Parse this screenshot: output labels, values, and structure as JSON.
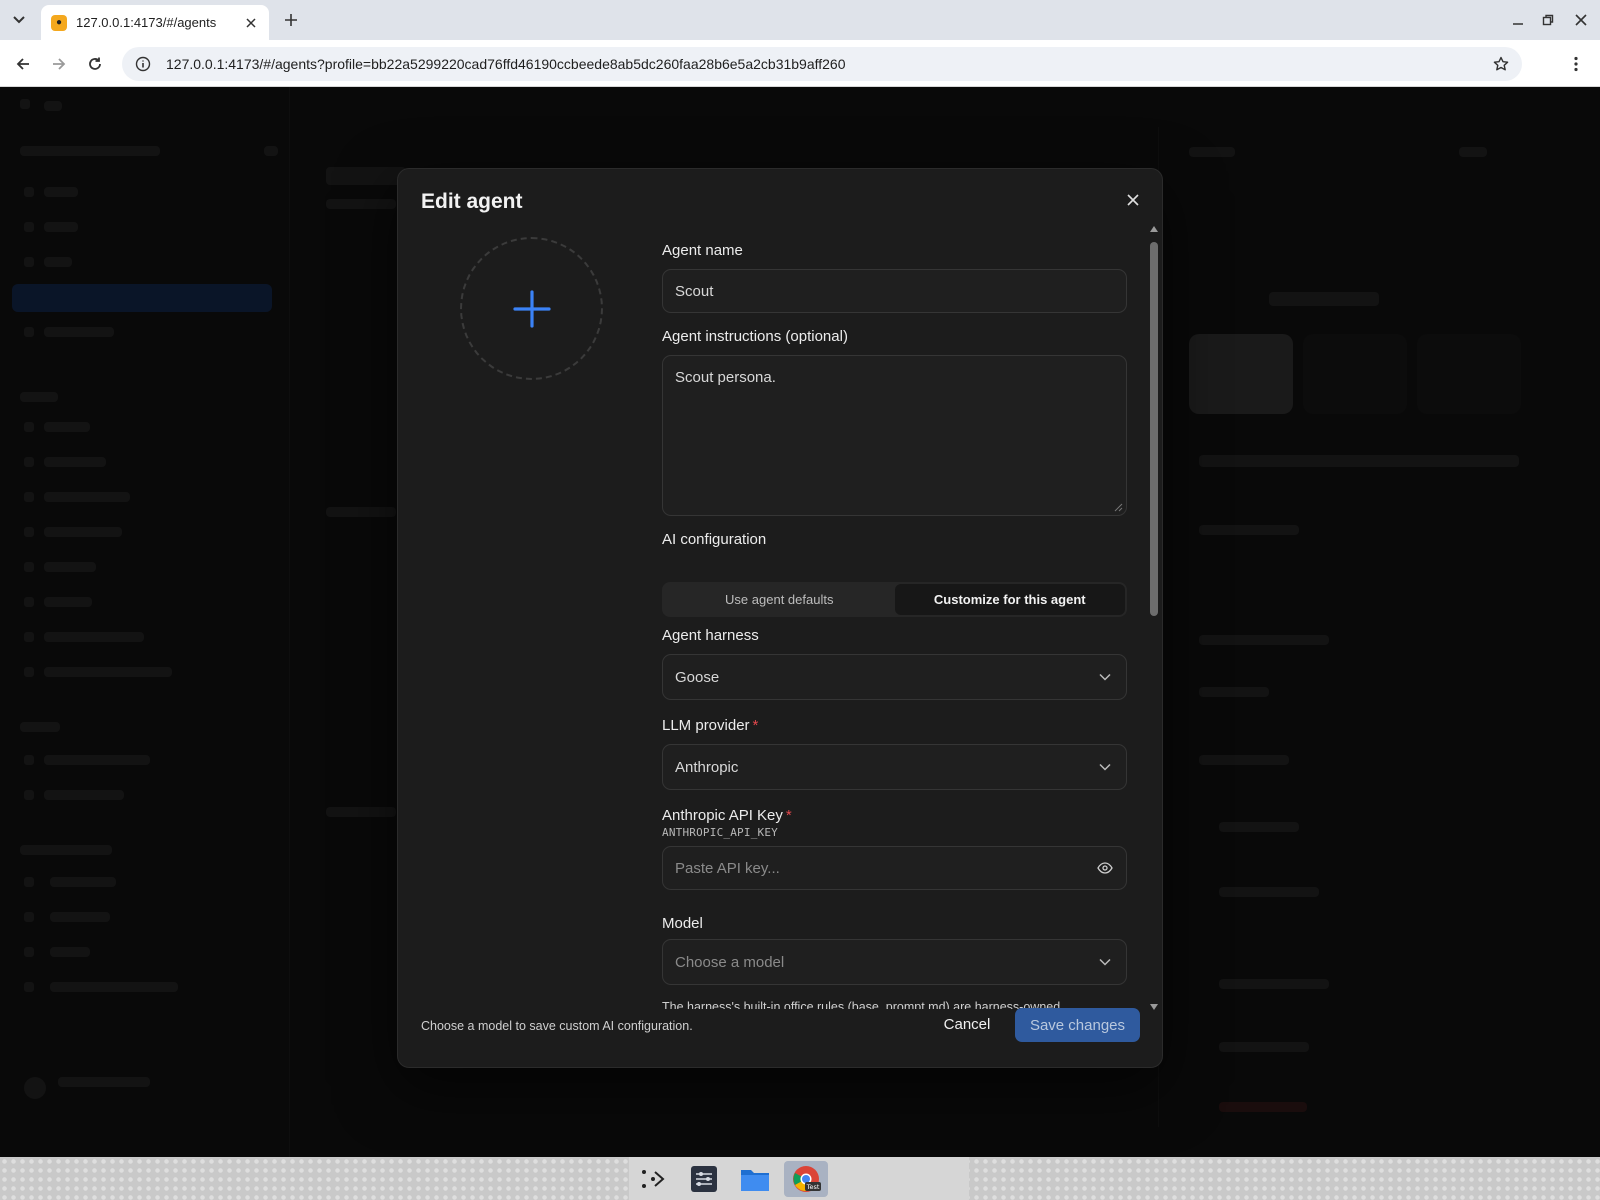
{
  "browser": {
    "tab_title": "127.0.0.1:4173/#/agents",
    "url": "127.0.0.1:4173/#/agents?profile=bb22a5299220cad76ffd46190ccbeede8ab5dc260faa28b6e5a2cb31b9aff260",
    "icons": [
      "tab-list-icon",
      "favicon-icon",
      "close-icon",
      "plus-icon",
      "minimize-icon",
      "restore-icon",
      "close-window-icon",
      "back-icon",
      "forward-icon",
      "reload-icon",
      "site-info-icon",
      "bookmark-star-icon",
      "kebab-menu-icon"
    ]
  },
  "modal": {
    "title": "Edit agent",
    "agent_name": {
      "label": "Agent name",
      "value": "Scout"
    },
    "instructions": {
      "label": "Agent instructions (optional)",
      "value": "Scout persona."
    },
    "ai_config": {
      "label": "AI configuration",
      "options": [
        "Use agent defaults",
        "Customize for this agent"
      ],
      "selected": "Customize for this agent"
    },
    "harness": {
      "label": "Agent harness",
      "value": "Goose"
    },
    "provider": {
      "label": "LLM provider",
      "required_mark": "*",
      "value": "Anthropic"
    },
    "api_key": {
      "label": "Anthropic API Key",
      "required_mark": "*",
      "env_var": "ANTHROPIC_API_KEY",
      "placeholder": "Paste API key..."
    },
    "model": {
      "label": "Model",
      "placeholder": "Choose a model"
    },
    "help_text": "The harness's built-in office rules (base_prompt.md) are harness-owned. Instructions for this Crew agent only are added when you fill in Agent instructions.",
    "footer_note": "Choose a model to save custom AI configuration.",
    "cancel_label": "Cancel",
    "save_label": "Save changes"
  },
  "colors": {
    "accent": "#3b82f6",
    "save_button": "#2f5a9e",
    "required": "#e5484d"
  },
  "taskbar": {
    "chrome_badge": "Test"
  }
}
